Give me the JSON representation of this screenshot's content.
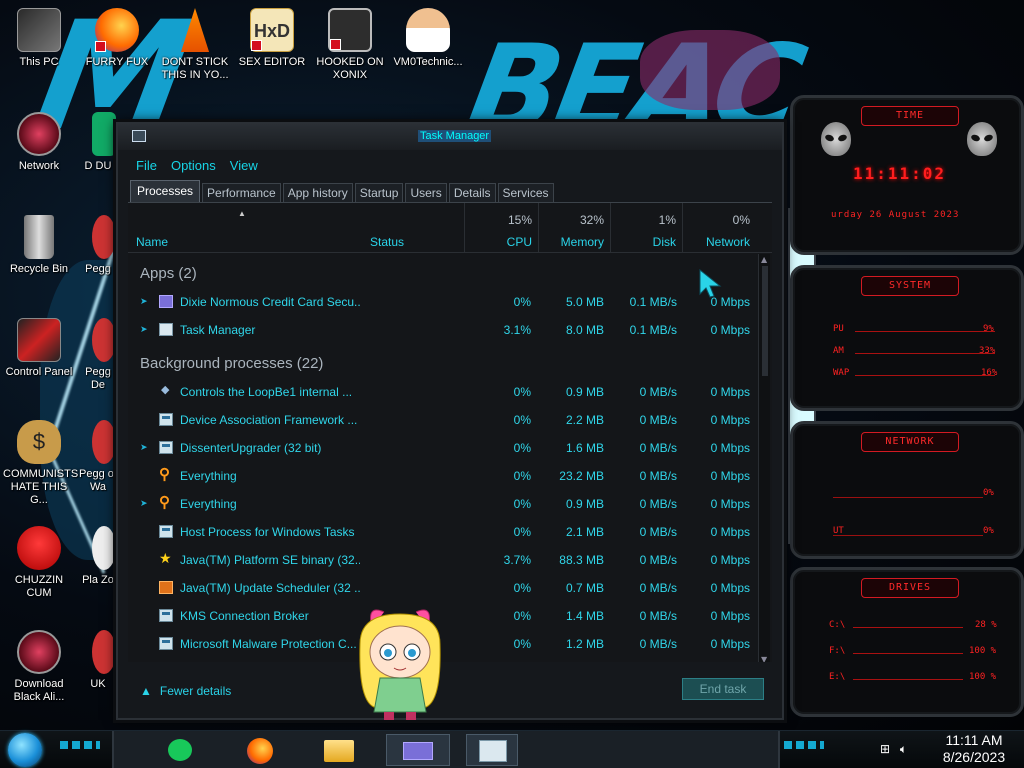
{
  "desktop": {
    "icons": [
      {
        "label": "This PC"
      },
      {
        "label": "FURRY FUX"
      },
      {
        "label": "DONT STICK THIS IN YO..."
      },
      {
        "label": "SEX EDITOR"
      },
      {
        "label": "HOOKED ON XONIX"
      },
      {
        "label": "VM0Technic..."
      },
      {
        "label": "Network"
      },
      {
        "label": "Recycle Bin"
      },
      {
        "label": "Control Panel"
      },
      {
        "label": "COMMUNISTS HATE THIS G..."
      },
      {
        "label": "CHUZZIN CUM"
      },
      {
        "label": "Download Black Ali..."
      }
    ],
    "partial_labels": [
      "D DU",
      "Pegg",
      "Pegg De",
      "Pegg of Wa",
      "Pla Zo",
      "UK"
    ]
  },
  "task_manager": {
    "title": "Task Manager",
    "menu": [
      "File",
      "Options",
      "View"
    ],
    "tabs": [
      "Processes",
      "Performance",
      "App history",
      "Startup",
      "Users",
      "Details",
      "Services"
    ],
    "active_tab": "Processes",
    "columns": {
      "name": "Name",
      "status": "Status",
      "cpu": {
        "label": "CPU",
        "pct": "15%"
      },
      "memory": {
        "label": "Memory",
        "pct": "32%"
      },
      "disk": {
        "label": "Disk",
        "pct": "1%"
      },
      "network": {
        "label": "Network",
        "pct": "0%"
      }
    },
    "groups": [
      {
        "label": "Apps (2)",
        "rows": [
          {
            "name": "Dixie Normous Credit Card Secu...",
            "cpu": "0%",
            "mem": "5.0 MB",
            "disk": "0.1 MB/s",
            "net": "0 Mbps",
            "expandable": true,
            "icon": "purple"
          },
          {
            "name": "Task Manager",
            "cpu": "3.1%",
            "mem": "8.0 MB",
            "disk": "0.1 MB/s",
            "net": "0 Mbps",
            "expandable": true,
            "icon": "taskm"
          }
        ]
      },
      {
        "label": "Background processes (22)",
        "rows": [
          {
            "name": "Controls the LoopBe1 internal ...",
            "cpu": "0%",
            "mem": "0.9 MB",
            "disk": "0 MB/s",
            "net": "0 Mbps",
            "expandable": false,
            "icon": "loop"
          },
          {
            "name": "Device Association Framework ...",
            "cpu": "0%",
            "mem": "2.2 MB",
            "disk": "0 MB/s",
            "net": "0 Mbps",
            "expandable": false,
            "icon": "box"
          },
          {
            "name": "DissenterUpgrader (32 bit)",
            "cpu": "0%",
            "mem": "1.6 MB",
            "disk": "0 MB/s",
            "net": "0 Mbps",
            "expandable": true,
            "icon": "box"
          },
          {
            "name": "Everything",
            "cpu": "0%",
            "mem": "23.2 MB",
            "disk": "0 MB/s",
            "net": "0 Mbps",
            "expandable": false,
            "icon": "search"
          },
          {
            "name": "Everything",
            "cpu": "0%",
            "mem": "0.9 MB",
            "disk": "0 MB/s",
            "net": "0 Mbps",
            "expandable": true,
            "icon": "search"
          },
          {
            "name": "Host Process for Windows Tasks",
            "cpu": "0%",
            "mem": "2.1 MB",
            "disk": "0 MB/s",
            "net": "0 Mbps",
            "expandable": false,
            "icon": "box"
          },
          {
            "name": "Java(TM) Platform SE binary (32...",
            "cpu": "3.7%",
            "mem": "88.3 MB",
            "disk": "0 MB/s",
            "net": "0 Mbps",
            "expandable": false,
            "icon": "star"
          },
          {
            "name": "Java(TM) Update Scheduler (32 ...",
            "cpu": "0%",
            "mem": "0.7 MB",
            "disk": "0 MB/s",
            "net": "0 Mbps",
            "expandable": false,
            "icon": "java"
          },
          {
            "name": "KMS Connection Broker",
            "cpu": "0%",
            "mem": "1.4 MB",
            "disk": "0 MB/s",
            "net": "0 Mbps",
            "expandable": false,
            "icon": "box"
          },
          {
            "name": "Microsoft Malware Protection C...",
            "cpu": "0%",
            "mem": "1.2 MB",
            "disk": "0 MB/s",
            "net": "0 Mbps",
            "expandable": false,
            "icon": "box"
          }
        ]
      }
    ],
    "fewer_details": "Fewer details",
    "end_task": "End task"
  },
  "gadgets": {
    "time": {
      "header": "TIME",
      "clock": "11:11:02",
      "date": "urday 26 August 2023"
    },
    "system": {
      "header": "SYSTEM",
      "rows": [
        {
          "label": "PU",
          "value": "9%"
        },
        {
          "label": "AM",
          "value": "33%"
        },
        {
          "label": "WAP",
          "value": "16%"
        }
      ]
    },
    "network": {
      "header": "NETWORK",
      "rows": [
        {
          "label": "",
          "value": "0%"
        },
        {
          "label": "UT",
          "value": "0%"
        }
      ]
    },
    "drives": {
      "header": "DRIVES",
      "rows": [
        {
          "label": "C:\\",
          "value": "28 %"
        },
        {
          "label": "F:\\",
          "value": "100 %"
        },
        {
          "label": "E:\\",
          "value": "100 %"
        }
      ]
    }
  },
  "taskbar": {
    "time": "11:11 AM",
    "date": "8/26/2023"
  },
  "colors": {
    "accent": "#17d4e6",
    "gadget_red": "#ff2222",
    "wallpaper_blue": "#15a8d8"
  }
}
